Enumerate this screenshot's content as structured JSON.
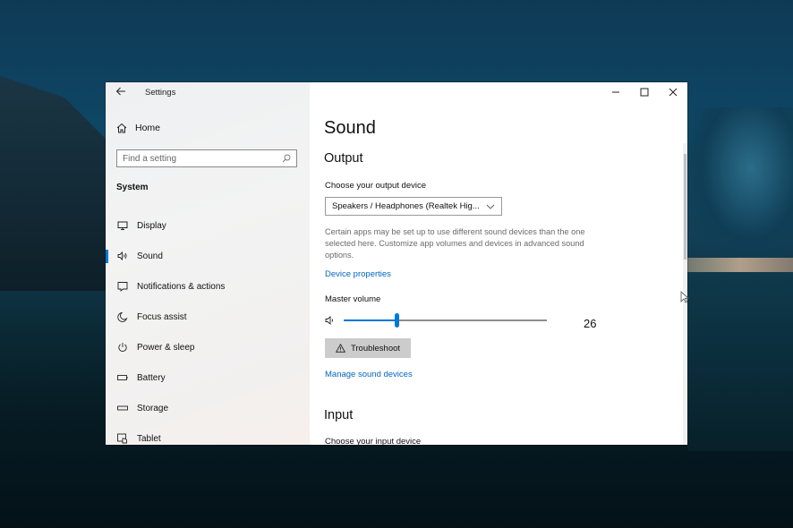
{
  "window": {
    "title": "Settings",
    "controls": {
      "minimize": "minimize",
      "maximize": "maximize",
      "close": "close"
    }
  },
  "sidebar": {
    "home_label": "Home",
    "search": {
      "placeholder": "Find a setting",
      "value": ""
    },
    "section_label": "System",
    "items": [
      {
        "label": "Display",
        "icon": "display-icon",
        "active": false
      },
      {
        "label": "Sound",
        "icon": "speaker-icon",
        "active": true
      },
      {
        "label": "Notifications & actions",
        "icon": "notification-icon",
        "active": false
      },
      {
        "label": "Focus assist",
        "icon": "moon-icon",
        "active": false
      },
      {
        "label": "Power & sleep",
        "icon": "power-icon",
        "active": false
      },
      {
        "label": "Battery",
        "icon": "battery-icon",
        "active": false
      },
      {
        "label": "Storage",
        "icon": "storage-icon",
        "active": false
      },
      {
        "label": "Tablet",
        "icon": "tablet-icon",
        "active": false
      }
    ]
  },
  "main": {
    "page_title": "Sound",
    "output": {
      "heading": "Output",
      "device_label": "Choose your output device",
      "device_selected": "Speakers / Headphones (Realtek Hig...",
      "description": "Certain apps may be set up to use different sound devices than the one selected here. Customize app volumes and devices in advanced sound options.",
      "device_properties_link": "Device properties",
      "master_volume_label": "Master volume",
      "master_volume_value": "26",
      "master_volume_fraction": 0.26,
      "troubleshoot_label": "Troubleshoot",
      "manage_link": "Manage sound devices"
    },
    "input": {
      "heading": "Input",
      "device_label": "Choose your input device"
    }
  },
  "colors": {
    "accent": "#0078d7",
    "link": "#0067c0",
    "button_bg": "#cccccc"
  }
}
